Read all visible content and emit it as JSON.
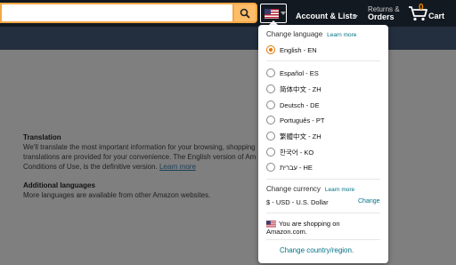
{
  "header": {
    "search_value": "",
    "account_greeting": "",
    "account_label": "Account & Lists",
    "returns_small": "Returns &",
    "returns_big": "Orders",
    "cart_count": "0",
    "cart_label": "Cart"
  },
  "page": {
    "translation_title": "Translation",
    "translation_line1": "We'll translate the most important information for your browsing, shopping",
    "translation_line2": "translations are provided for your convenience. The English version of Am",
    "translation_line3": "Conditions of Use, is the definitive version.",
    "learn_more": "Learn more",
    "additional_title": "Additional languages",
    "additional_text": "More languages are available from other Amazon websites."
  },
  "popover": {
    "change_language": "Change language",
    "learn_more": "Learn more",
    "languages": [
      {
        "label": "English - EN",
        "selected": true
      },
      {
        "label": "Español - ES",
        "selected": false
      },
      {
        "label": "简体中文 - ZH",
        "selected": false
      },
      {
        "label": "Deutsch - DE",
        "selected": false
      },
      {
        "label": "Português - PT",
        "selected": false
      },
      {
        "label": "繁體中文 - ZH",
        "selected": false
      },
      {
        "label": "한국어 - KO",
        "selected": false
      },
      {
        "label": "עברית - HE",
        "selected": false
      }
    ],
    "change_currency": "Change currency",
    "currency_learn_more": "Learn more",
    "currency_value": "$ - USD - U.S. Dollar",
    "currency_change": "Change",
    "shopping_line1": "You are shopping on",
    "shopping_line2": "Amazon.com.",
    "change_country": "Change country/region."
  },
  "colors": {
    "header_bg": "#232f3e",
    "topbar_bg": "#131921",
    "search_button": "#febd69",
    "accent_orange": "#e77600",
    "link_teal": "#007185"
  },
  "icons": [
    "search-icon",
    "us-flag-icon",
    "chevron-down-icon",
    "cart-icon"
  ]
}
